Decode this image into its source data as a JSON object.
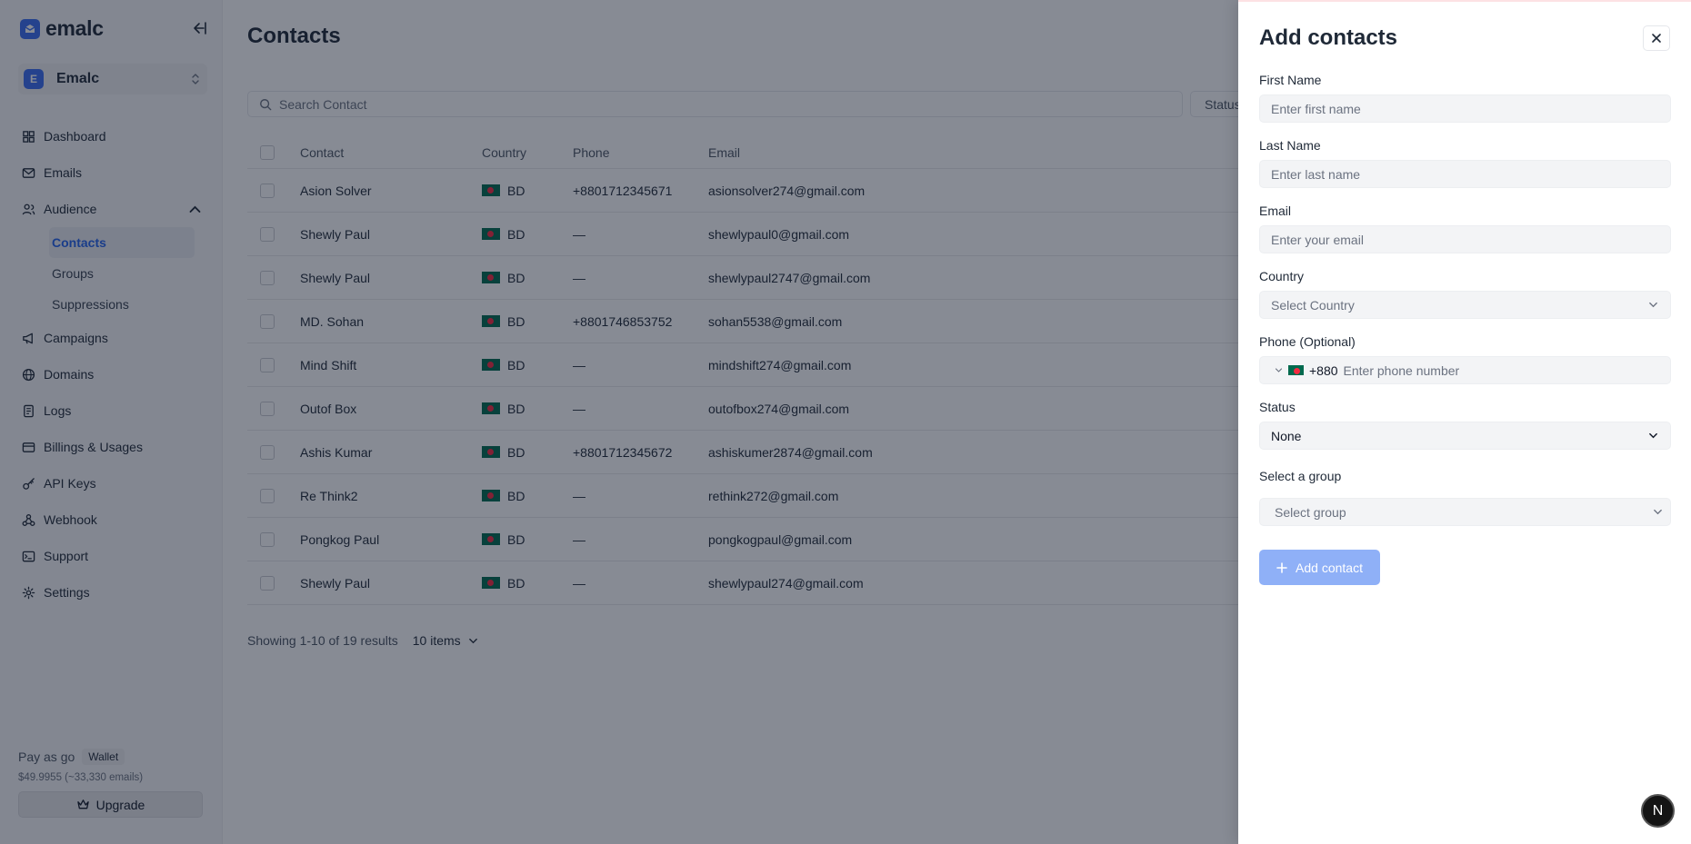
{
  "brand": {
    "name": "emalc"
  },
  "workspace": {
    "initial": "E",
    "name": "Emalc"
  },
  "nav": {
    "items": [
      {
        "label": "Dashboard"
      },
      {
        "label": "Emails"
      },
      {
        "label": "Audience"
      },
      {
        "label": "Campaigns"
      },
      {
        "label": "Domains"
      },
      {
        "label": "Logs"
      },
      {
        "label": "Billings & Usages"
      },
      {
        "label": "API Keys"
      },
      {
        "label": "Webhook"
      },
      {
        "label": "Support"
      },
      {
        "label": "Settings"
      }
    ],
    "audience_sub": [
      {
        "label": "Contacts"
      },
      {
        "label": "Groups"
      },
      {
        "label": "Suppressions"
      }
    ]
  },
  "footer": {
    "plan": "Pay as go",
    "wallet_badge": "Wallet",
    "balance": "$49.9955 (~33,330 emails)",
    "upgrade_label": "Upgrade"
  },
  "page": {
    "title": "Contacts"
  },
  "search": {
    "placeholder": "Search Contact"
  },
  "status_filter": {
    "label": "Status"
  },
  "table": {
    "headers": {
      "contact": "Contact",
      "country": "Country",
      "phone": "Phone",
      "email": "Email"
    },
    "rows": [
      {
        "contact": "Asion Solver",
        "country": "BD",
        "phone": "+8801712345671",
        "email": "asionsolver274@gmail.com"
      },
      {
        "contact": "Shewly Paul",
        "country": "BD",
        "phone": "—",
        "email": "shewlypaul0@gmail.com"
      },
      {
        "contact": "Shewly Paul",
        "country": "BD",
        "phone": "—",
        "email": "shewlypaul2747@gmail.com"
      },
      {
        "contact": "MD. Sohan",
        "country": "BD",
        "phone": "+8801746853752",
        "email": "sohan5538@gmail.com"
      },
      {
        "contact": "Mind Shift",
        "country": "BD",
        "phone": "—",
        "email": "mindshift274@gmail.com"
      },
      {
        "contact": "Outof Box",
        "country": "BD",
        "phone": "—",
        "email": "outofbox274@gmail.com"
      },
      {
        "contact": "Ashis Kumar",
        "country": "BD",
        "phone": "+8801712345672",
        "email": "ashiskumer2874@gmail.com"
      },
      {
        "contact": "Re Think2",
        "country": "BD",
        "phone": "—",
        "email": "rethink272@gmail.com"
      },
      {
        "contact": "Pongkog Paul",
        "country": "BD",
        "phone": "—",
        "email": "pongkogpaul@gmail.com"
      },
      {
        "contact": "Shewly Paul",
        "country": "BD",
        "phone": "—",
        "email": "shewlypaul274@gmail.com"
      }
    ]
  },
  "pager": {
    "summary": "Showing 1-10 of 19 results",
    "items_per_page": "10 items"
  },
  "drawer": {
    "title": "Add contacts",
    "first_name": {
      "label": "First Name",
      "placeholder": "Enter first name"
    },
    "last_name": {
      "label": "Last Name",
      "placeholder": "Enter last name"
    },
    "email": {
      "label": "Email",
      "placeholder": "Enter your email"
    },
    "country": {
      "label": "Country",
      "placeholder": "Select Country"
    },
    "phone": {
      "label": "Phone (Optional)",
      "dial_code": "+880",
      "placeholder": "Enter phone number"
    },
    "status": {
      "label": "Status",
      "value": "None"
    },
    "group": {
      "label": "Select a group",
      "placeholder": "Select group"
    },
    "submit_label": "Add contact"
  },
  "fab": {
    "label": "N"
  }
}
